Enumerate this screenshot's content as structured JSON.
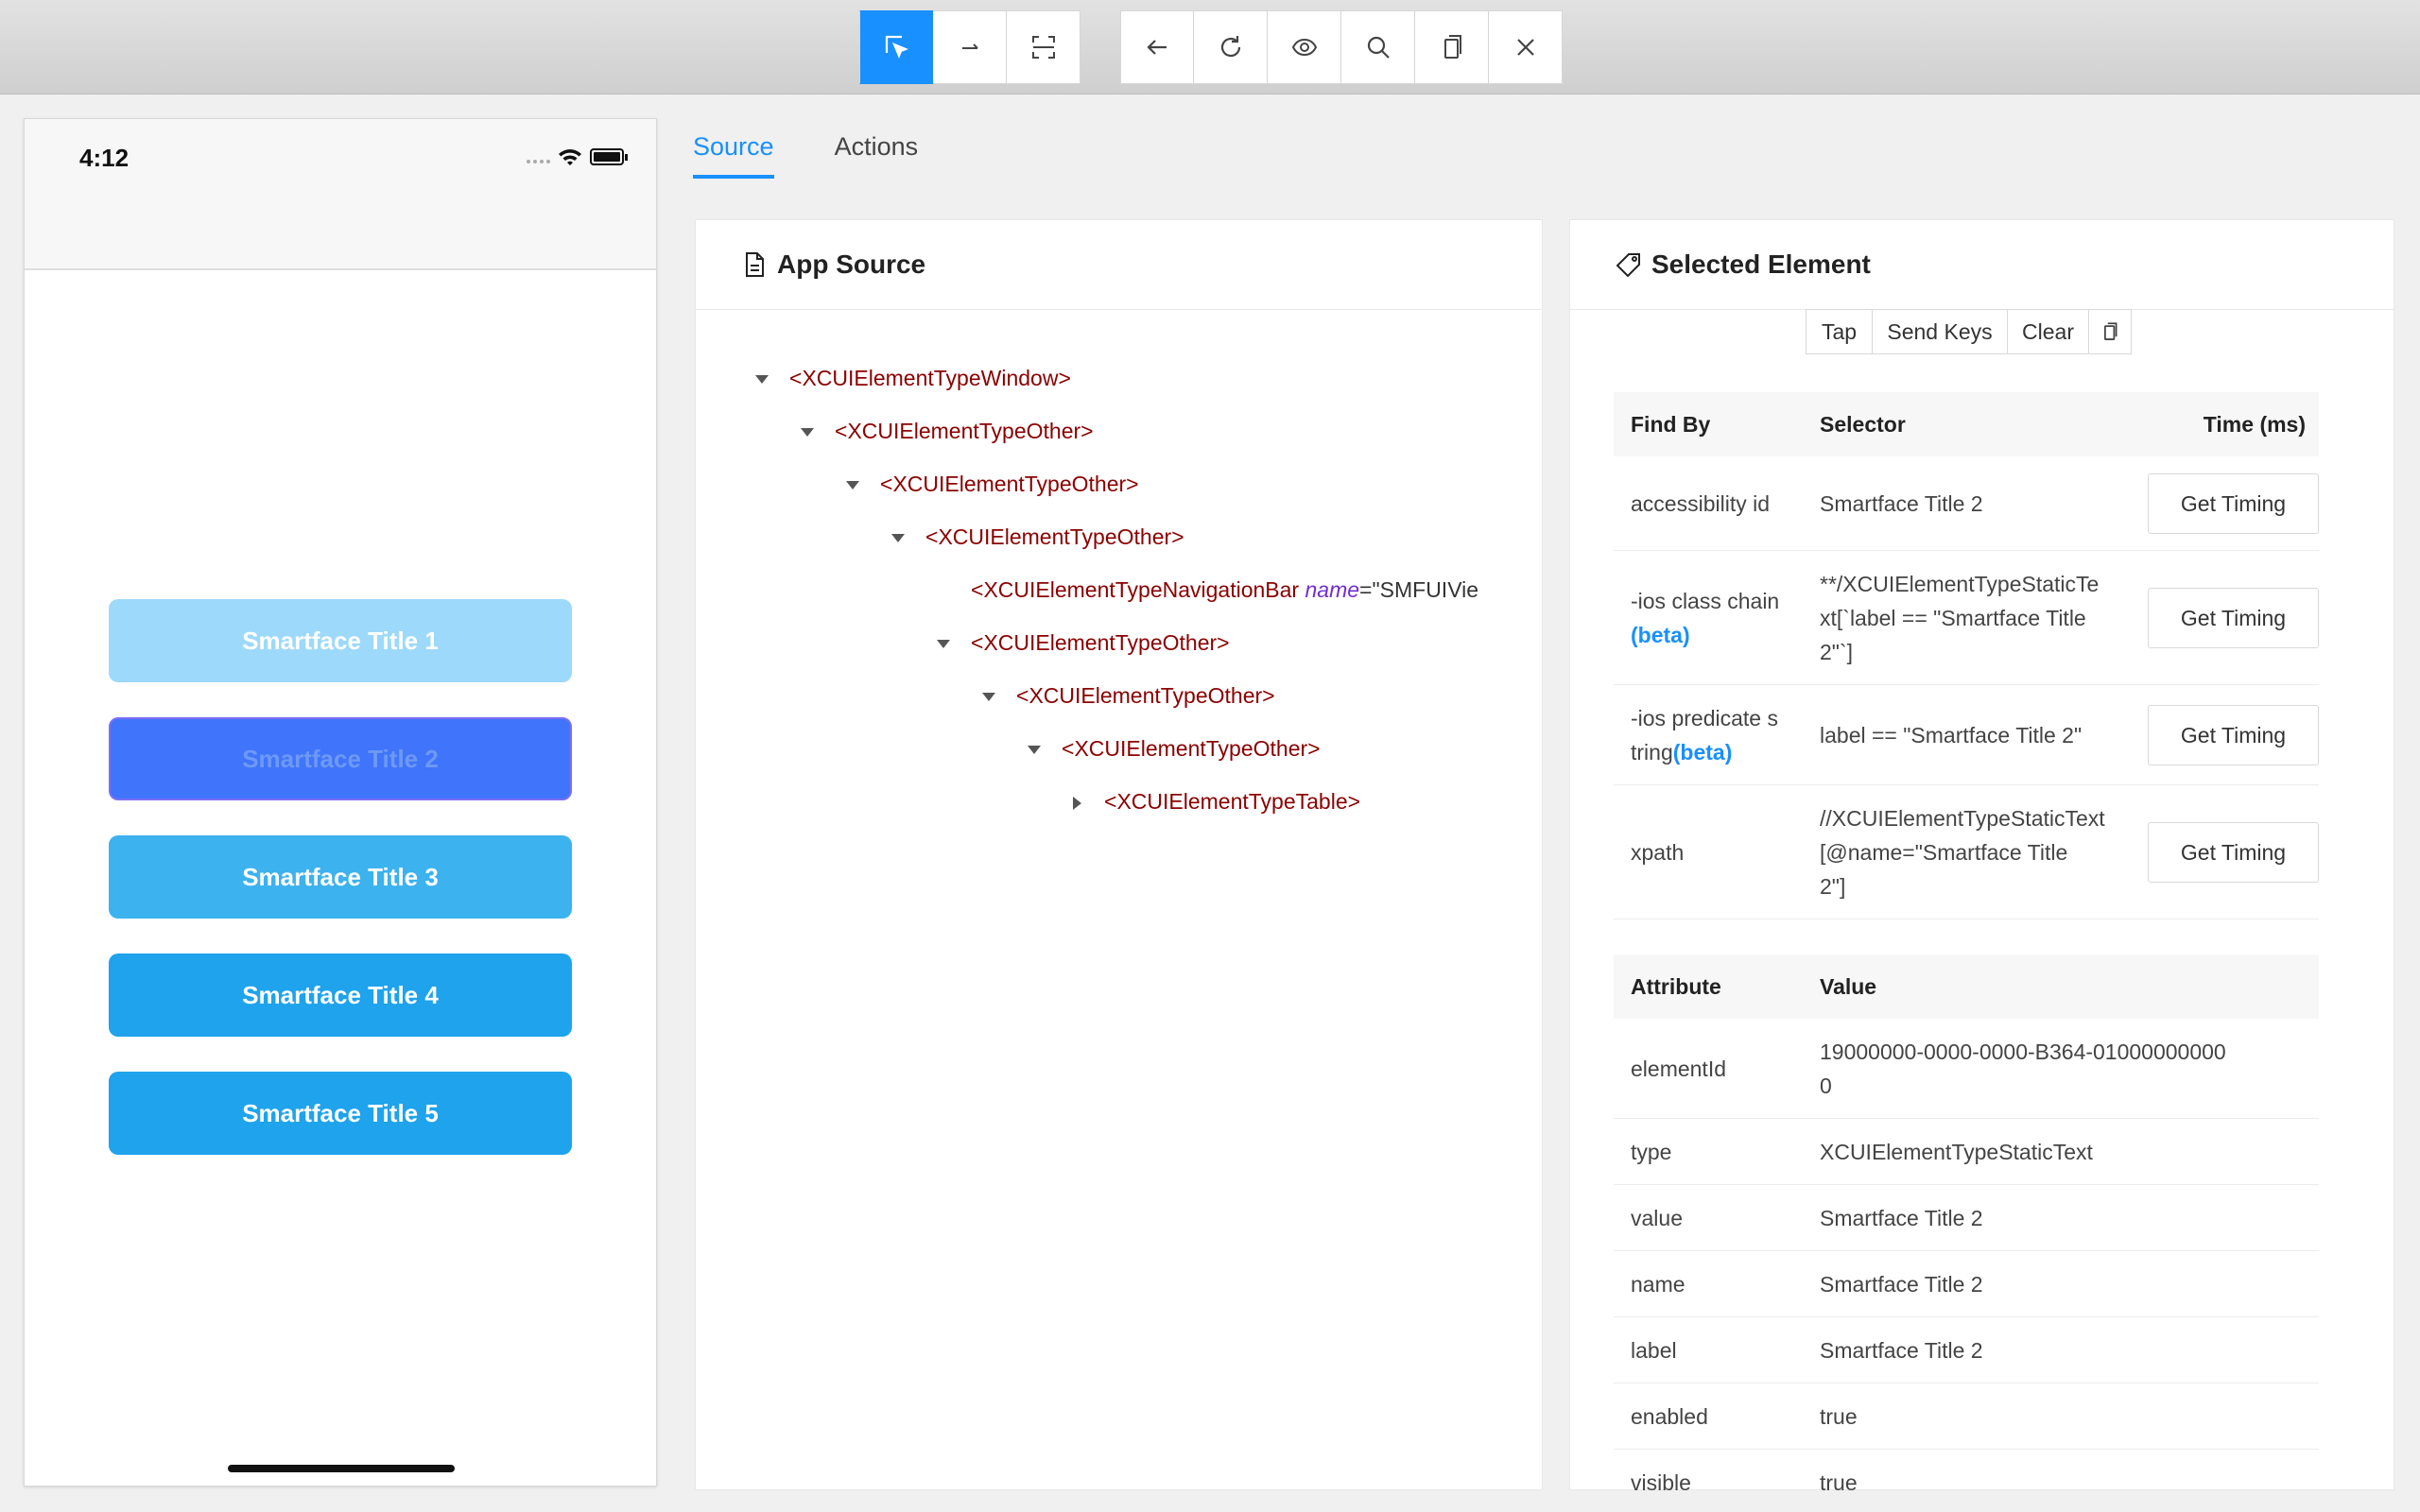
{
  "toolbar": {
    "group1": [
      {
        "name": "select-elements",
        "icon": "select-cursor-icon",
        "active": true
      },
      {
        "name": "swipe-by-coordinates",
        "icon": "swipe-arrow-icon",
        "active": false
      },
      {
        "name": "tap-by-coordinates",
        "icon": "scan-frame-icon",
        "active": false
      }
    ],
    "group2": [
      {
        "name": "back",
        "icon": "arrow-left-icon"
      },
      {
        "name": "refresh",
        "icon": "refresh-icon"
      },
      {
        "name": "start-recording",
        "icon": "eye-icon"
      },
      {
        "name": "search",
        "icon": "search-icon"
      },
      {
        "name": "copy-xml",
        "icon": "copy-icon"
      },
      {
        "name": "quit-session",
        "icon": "close-icon"
      }
    ]
  },
  "device": {
    "time": "4:12",
    "buttons": [
      {
        "label": "Smartface Title 1",
        "color": "#9dd9fa",
        "text_color": "#ffffff"
      },
      {
        "label": "Smartface Title 2",
        "color": "#3f74fb",
        "text_color": "#6d99f6"
      },
      {
        "label": "Smartface Title 3",
        "color": "#3cb2ee",
        "text_color": "#ffffff"
      },
      {
        "label": "Smartface Title 4",
        "color": "#1ea3ec",
        "text_color": "#ffffff"
      },
      {
        "label": "Smartface Title 5",
        "color": "#1ea3ec",
        "text_color": "#ffffff"
      }
    ]
  },
  "tabs": [
    {
      "label": "Source",
      "active": true
    },
    {
      "label": "Actions",
      "active": false
    }
  ],
  "app_source": {
    "title": "App Source",
    "tree": [
      {
        "tag": "XCUIElementTypeWindow",
        "depth": 0,
        "caret": "down"
      },
      {
        "tag": "XCUIElementTypeOther",
        "depth": 1,
        "caret": "down"
      },
      {
        "tag": "XCUIElementTypeOther",
        "depth": 2,
        "caret": "down"
      },
      {
        "tag": "XCUIElementTypeOther",
        "depth": 3,
        "caret": "down"
      },
      {
        "tag": "XCUIElementTypeNavigationBar",
        "depth": 4,
        "caret": "none",
        "attr_name": "name",
        "attr_value": "\"SMFUIVie"
      },
      {
        "tag": "XCUIElementTypeOther",
        "depth": 4,
        "caret": "down"
      },
      {
        "tag": "XCUIElementTypeOther",
        "depth": 5,
        "caret": "down"
      },
      {
        "tag": "XCUIElementTypeOther",
        "depth": 6,
        "caret": "down"
      },
      {
        "tag": "XCUIElementTypeTable",
        "depth": 7,
        "caret": "right"
      }
    ]
  },
  "selected_element": {
    "title": "Selected Element",
    "actions": [
      "Tap",
      "Send Keys",
      "Clear"
    ],
    "find_by_headers": {
      "find_by": "Find By",
      "selector": "Selector",
      "time": "Time (ms)"
    },
    "find_by_rows": [
      {
        "strategy": "accessibility id",
        "beta": "",
        "selector_lines": [
          "Smartface Title 2"
        ],
        "button": "Get Timing"
      },
      {
        "strategy": "-ios class chain",
        "beta": "(beta)",
        "selector_lines": [
          "**/XCUIElementTypeStaticTe",
          "xt[`label == \"Smartface Title",
          "2\"`]"
        ],
        "button": "Get Timing"
      },
      {
        "strategy": "-ios predicate s",
        "strategy2": "tring",
        "beta": "(beta)",
        "selector_lines": [
          "label == \"Smartface Title 2\""
        ],
        "button": "Get Timing"
      },
      {
        "strategy": "xpath",
        "beta": "",
        "selector_lines": [
          "//XCUIElementTypeStaticText",
          "[@name=\"Smartface Title",
          "2\"]"
        ],
        "button": "Get Timing"
      }
    ],
    "attr_headers": {
      "attribute": "Attribute",
      "value": "Value"
    },
    "attributes": [
      {
        "name": "elementId",
        "value_lines": [
          "19000000-0000-0000-B364-01000000000",
          "0"
        ]
      },
      {
        "name": "type",
        "value_lines": [
          "XCUIElementTypeStaticText"
        ]
      },
      {
        "name": "value",
        "value_lines": [
          "Smartface Title 2"
        ]
      },
      {
        "name": "name",
        "value_lines": [
          "Smartface Title 2"
        ]
      },
      {
        "name": "label",
        "value_lines": [
          "Smartface Title 2"
        ]
      },
      {
        "name": "enabled",
        "value_lines": [
          "true"
        ]
      },
      {
        "name": "visible",
        "value_lines": [
          "true"
        ]
      }
    ]
  }
}
